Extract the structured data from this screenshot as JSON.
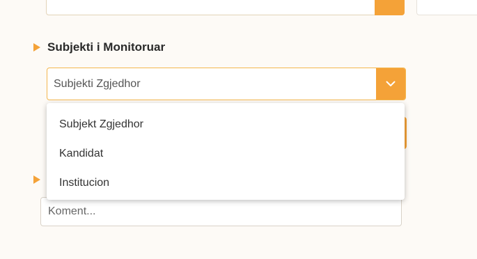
{
  "section_monitored": {
    "heading": "Subjekti i Monitoruar"
  },
  "subject_select": {
    "selected_value": "Subjekti Zgjedhor",
    "toggle_icon": "chevron-down-icon",
    "options": [
      "Subjekt Zgjedhor",
      "Kandidat",
      "Institucion"
    ]
  },
  "comment": {
    "placeholder": "Koment..."
  },
  "colors": {
    "accent": "#f4a238",
    "select_border": "#f4b64d",
    "background": "#fdfaf6"
  }
}
